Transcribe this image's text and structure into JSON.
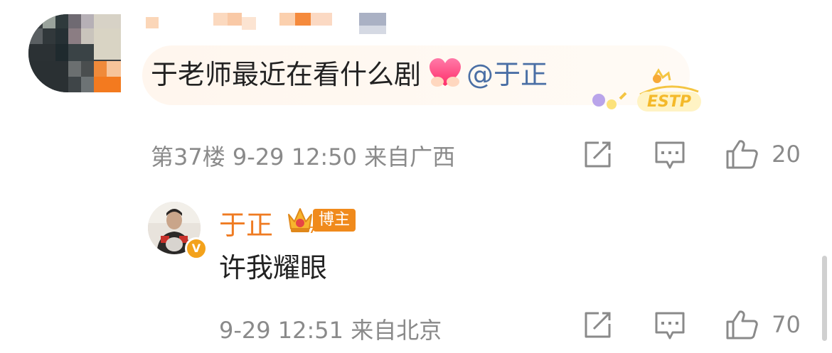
{
  "comment": {
    "text": "于老师最近在看什么剧",
    "mention": "@于正",
    "emoji": "heart-hands-emoji",
    "badge_text": "ESTP",
    "floor": "第37楼",
    "time": "9-29 12:50",
    "location": "来自广西",
    "likes": "20"
  },
  "reply": {
    "author": "于正",
    "author_color": "#ef7b22",
    "role_badge": "博主",
    "verified_badge": "V",
    "text": "许我耀眼",
    "time": "9-29 12:51",
    "location": "来自北京",
    "likes": "70"
  },
  "icons": [
    "share-icon",
    "comment-icon",
    "like-icon"
  ],
  "colors": {
    "accent": "#ef7b22",
    "mention": "#4a6fa5",
    "meta": "#8a8a8a",
    "bubble": "#fff6ee"
  }
}
